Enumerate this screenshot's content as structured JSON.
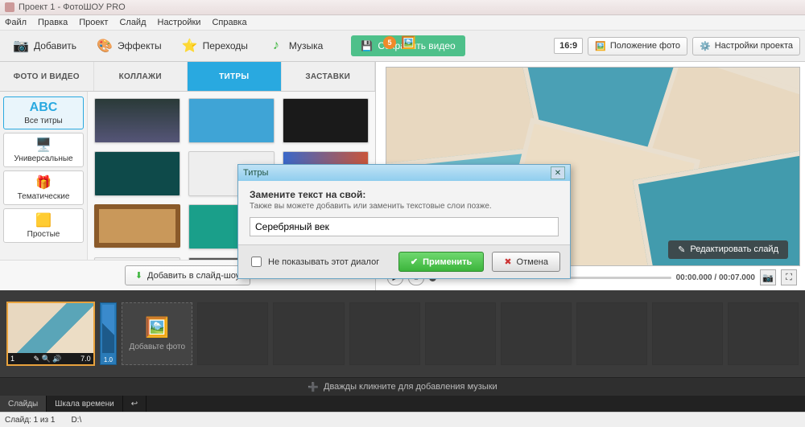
{
  "window": {
    "title": "Проект 1 - ФотоШОУ PRO"
  },
  "menu": [
    "Файл",
    "Правка",
    "Проект",
    "Слайд",
    "Настройки",
    "Справка"
  ],
  "toolbar": {
    "add": "Добавить",
    "effects": "Эффекты",
    "transitions": "Переходы",
    "music": "Музыка",
    "save": "Сохранить видео",
    "aspect": "16:9",
    "photo_pos": "Положение фото",
    "proj_settings": "Настройки проекта",
    "notif_count": "5"
  },
  "tabs": [
    "ФОТО И ВИДЕО",
    "КОЛЛАЖИ",
    "ТИТРЫ",
    "ЗАСТАВКИ"
  ],
  "active_tab": 2,
  "cats": [
    {
      "icon": "ABC",
      "label": "Все титры",
      "active": true
    },
    {
      "icon": "🖥️",
      "label": "Универсальные"
    },
    {
      "icon": "🎁",
      "label": "Тематические"
    },
    {
      "icon": "🟨",
      "label": "Простые"
    }
  ],
  "add_slideshow": "Добавить в слайд-шоу",
  "preview": {
    "edit_slide": "Редактировать слайд",
    "time": "00:00.000 / 00:07.000"
  },
  "timeline": {
    "slide_num": "1",
    "slide_dur": "7.0",
    "trans_dur": "1.0",
    "add_photo": "Добавьте фото",
    "music_hint": "Дважды кликните для добавления музыки"
  },
  "bottom_tabs": [
    "Слайды",
    "Шкала времени"
  ],
  "status": {
    "slide": "Слайд: 1 из 1",
    "path": "D:\\"
  },
  "dialog": {
    "title": "Титры",
    "heading": "Замените текст на свой:",
    "sub": "Также вы можете добавить или заменить текстовые слои позже.",
    "value": "Серебряный век",
    "dont_show": "Не показывать этот диалог",
    "apply": "Применить",
    "cancel": "Отмена"
  }
}
